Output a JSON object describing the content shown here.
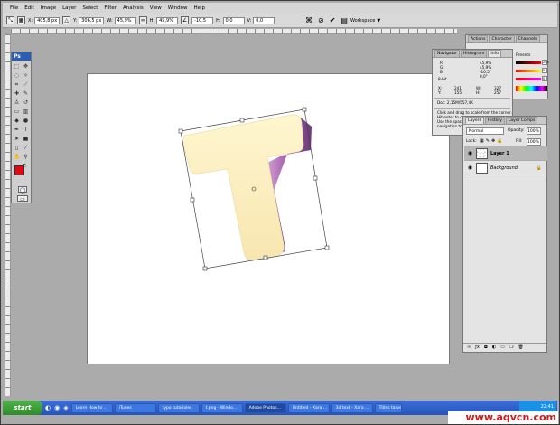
{
  "menu": [
    "File",
    "Edit",
    "Image",
    "Layer",
    "Select",
    "Filter",
    "Analysis",
    "View",
    "Window",
    "Help"
  ],
  "options": {
    "x_label": "X:",
    "x_value": "405,8 px",
    "y_label": "Y:",
    "y_value": "306,5 px",
    "w_label": "W:",
    "w_value": "45,9%",
    "h_label": "H:",
    "h_value": "45,9%",
    "angle_value": "-10,5",
    "hskew_label": "H:",
    "hskew_value": "0,0",
    "vskew_label": "V:",
    "vskew_value": "0,0",
    "workspace": "Workspace"
  },
  "toolbox": {
    "logo": "Ps"
  },
  "navigator": {
    "tabs": [
      "Navigator",
      "Histogram",
      "Info"
    ],
    "rgb_labels": [
      "R:",
      "G:",
      "B:"
    ],
    "depth": "8-bit",
    "cmyk_labels": [
      "C:",
      "M:",
      "Y:",
      "K:"
    ],
    "pct_values": [
      "45,9%",
      "45,9%",
      "-10,5°",
      "0,0°"
    ],
    "x": "X:",
    "y": "Y:",
    "xy_values": [
      "241",
      "155"
    ],
    "w": "W:",
    "h": "H:",
    "wh_values": [
      "327",
      "257"
    ],
    "doc": "Doc: 2,15M/557,4K",
    "hint": [
      "Click and drag to scale from the corner.",
      "Hit enter to co",
      "Use the spaceb",
      "navigation tools"
    ]
  },
  "swatches_panel": {
    "tabs": [
      "Actions",
      "Character",
      "Channels"
    ],
    "subtab": "Presets",
    "values": [
      "255",
      "0",
      "0"
    ]
  },
  "layers": {
    "tabs": [
      "Layers",
      "History",
      "Layer Comps"
    ],
    "blend_mode": "Normal",
    "opacity_label": "Opacity:",
    "opacity": "100%",
    "lock_label": "Lock:",
    "fill_label": "Fill:",
    "fill": "100%",
    "items": [
      {
        "name": "Layer 1",
        "selected": true
      },
      {
        "name": "Background",
        "selected": false
      }
    ]
  },
  "taskbar": {
    "start": "start",
    "items": [
      "Learn How to ...",
      "iTunes",
      "typo tutoriales",
      "t.png - Windo...",
      "Adobe Photos...",
      "Untitled - Xara ...",
      "3d text - Xara ...",
      "Titles tarvelo..."
    ],
    "active_index": 4,
    "clock": "22:41"
  },
  "watermark": "www.aqvcn.com",
  "colors": {
    "foreground": "#e30613",
    "background": "#000000",
    "t_face": "#fdf3c4",
    "t_side": "#9e6aa8"
  }
}
